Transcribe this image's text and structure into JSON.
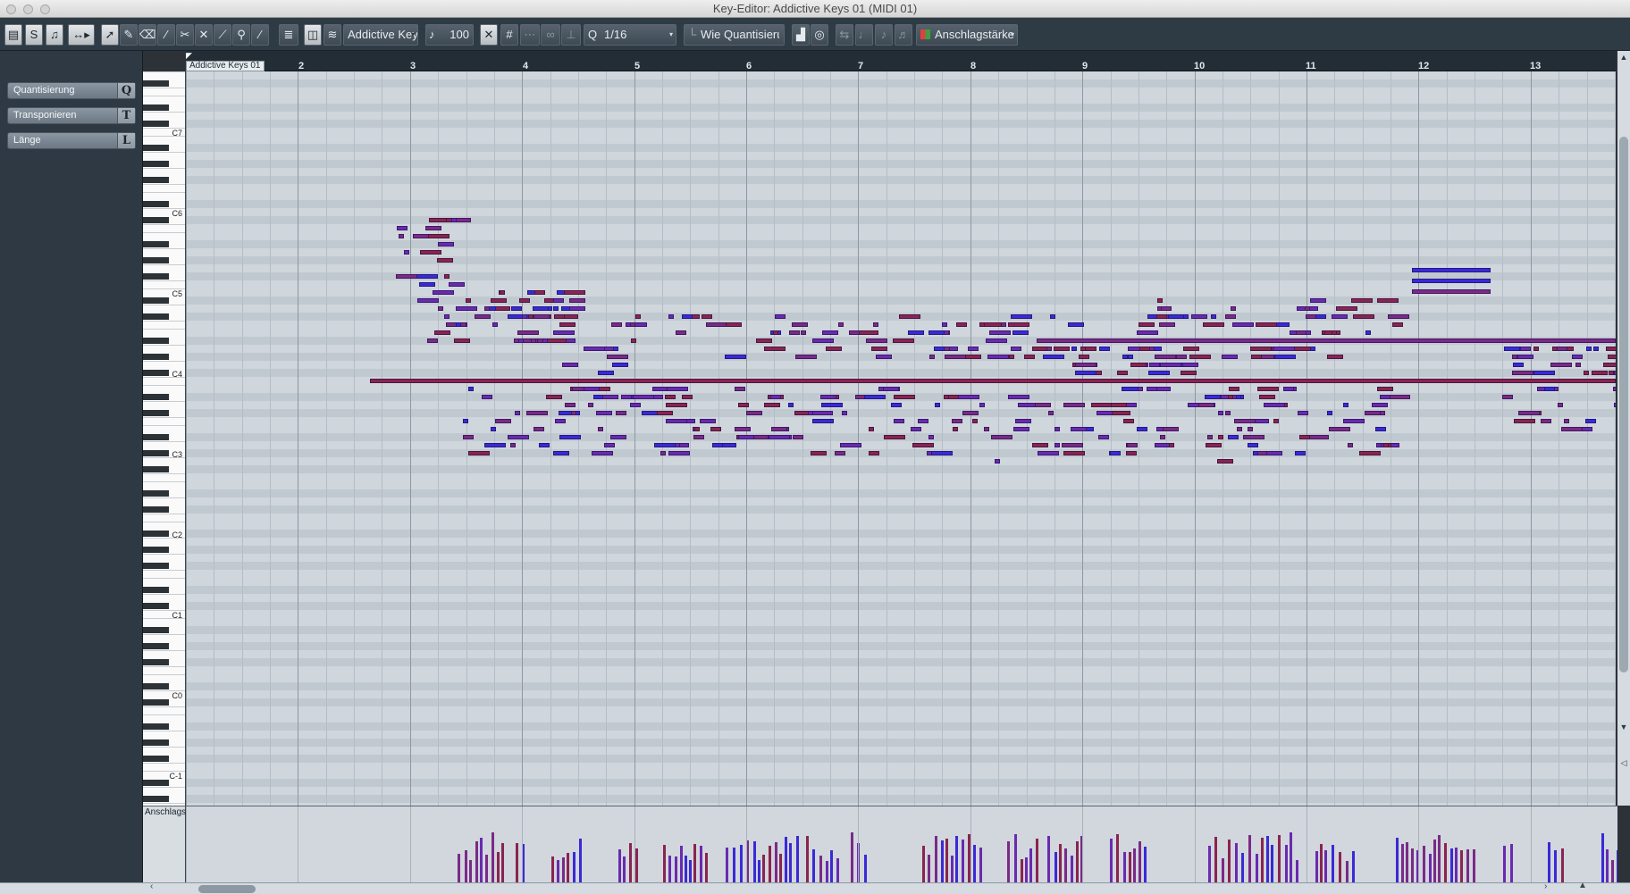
{
  "window": {
    "title": "Key-Editor: Addictive Keys 01 (MIDI 01)"
  },
  "toolbar": {
    "instrument": "Addictive Key",
    "velocity": "100",
    "quantize_label": "Q",
    "quantize": "1/16",
    "length_quantize": "Wie Quantisierung",
    "controller_lane": "Anschlagstärke"
  },
  "inspector": {
    "items": [
      {
        "label": "Quantisierung",
        "key": "Q"
      },
      {
        "label": "Transponieren",
        "key": "T"
      },
      {
        "label": "Länge",
        "key": "L"
      }
    ]
  },
  "ruler": {
    "part_label": "Addictive Keys 01",
    "bars": [
      "2",
      "3",
      "4",
      "5",
      "6",
      "7",
      "8",
      "9",
      "10",
      "11",
      "12",
      "13"
    ]
  },
  "keyboard": {
    "octave_labels": [
      "C7",
      "C6",
      "C5",
      "C4",
      "C3",
      "C2",
      "C1",
      "C0",
      "C-1"
    ]
  },
  "velocity_lane": {
    "label": "Anschlagstärke"
  },
  "colors": {
    "note_purple": "#7a2a88",
    "note_blue": "#3a2ad6",
    "note_red": "#8a2450",
    "grid_bg": "#cfd6dc"
  }
}
